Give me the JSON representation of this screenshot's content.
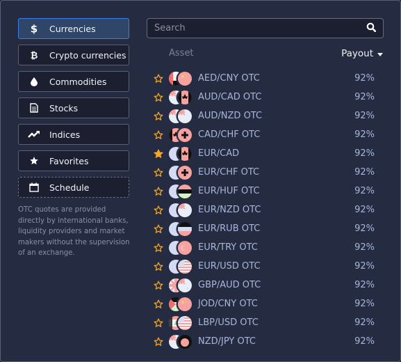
{
  "sidebar": {
    "categories": [
      {
        "label": "Currencies",
        "icon": "dollar-icon",
        "active": true
      },
      {
        "label": "Crypto currencies",
        "icon": "bitcoin-icon",
        "active": false
      },
      {
        "label": "Commodities",
        "icon": "drop-icon",
        "active": false
      },
      {
        "label": "Stocks",
        "icon": "document-icon",
        "active": false
      },
      {
        "label": "Indices",
        "icon": "trend-icon",
        "active": false
      },
      {
        "label": "Favorites",
        "icon": "star-icon",
        "active": false
      },
      {
        "label": "Schedule",
        "icon": "calendar-icon",
        "active": false
      }
    ],
    "note": "OTC quotes are provided directly by international banks, liquidity providers and market makers without the supervision of an exchange."
  },
  "search": {
    "placeholder": "Search",
    "value": ""
  },
  "table": {
    "asset_header": "Asset",
    "payout_header": "Payout",
    "rows": [
      {
        "asset": "AED/CNY OTC",
        "payout": "92%",
        "favorite": false,
        "flags": [
          "ae",
          "cn"
        ]
      },
      {
        "asset": "AUD/CAD OTC",
        "payout": "92%",
        "favorite": false,
        "flags": [
          "au",
          "ca"
        ]
      },
      {
        "asset": "AUD/NZD OTC",
        "payout": "92%",
        "favorite": false,
        "flags": [
          "au",
          "nz"
        ]
      },
      {
        "asset": "CAD/CHF OTC",
        "payout": "92%",
        "favorite": false,
        "flags": [
          "ca",
          "ch"
        ]
      },
      {
        "asset": "EUR/CAD",
        "payout": "92%",
        "favorite": true,
        "flags": [
          "eu",
          "ca"
        ]
      },
      {
        "asset": "EUR/CHF OTC",
        "payout": "92%",
        "favorite": false,
        "flags": [
          "eu",
          "ch"
        ]
      },
      {
        "asset": "EUR/HUF OTC",
        "payout": "92%",
        "favorite": false,
        "flags": [
          "eu",
          "hu"
        ]
      },
      {
        "asset": "EUR/NZD OTC",
        "payout": "92%",
        "favorite": false,
        "flags": [
          "eu",
          "nz"
        ]
      },
      {
        "asset": "EUR/RUB OTC",
        "payout": "92%",
        "favorite": false,
        "flags": [
          "eu",
          "ru"
        ]
      },
      {
        "asset": "EUR/TRY OTC",
        "payout": "92%",
        "favorite": false,
        "flags": [
          "eu",
          "tr"
        ]
      },
      {
        "asset": "EUR/USD OTC",
        "payout": "92%",
        "favorite": false,
        "flags": [
          "eu",
          "us"
        ]
      },
      {
        "asset": "GBP/AUD OTC",
        "payout": "92%",
        "favorite": false,
        "flags": [
          "gb",
          "au"
        ]
      },
      {
        "asset": "JOD/CNY OTC",
        "payout": "92%",
        "favorite": false,
        "flags": [
          "jo",
          "cn"
        ]
      },
      {
        "asset": "LBP/USD OTC",
        "payout": "92%",
        "favorite": false,
        "flags": [
          "lb",
          "us"
        ]
      },
      {
        "asset": "NZD/JPY OTC",
        "payout": "92%",
        "favorite": false,
        "flags": [
          "nz",
          "jp"
        ]
      }
    ]
  },
  "colors": {
    "accent": "#3d7ee0",
    "star": "#f5a623",
    "asset_text": "#a8b6d8"
  }
}
